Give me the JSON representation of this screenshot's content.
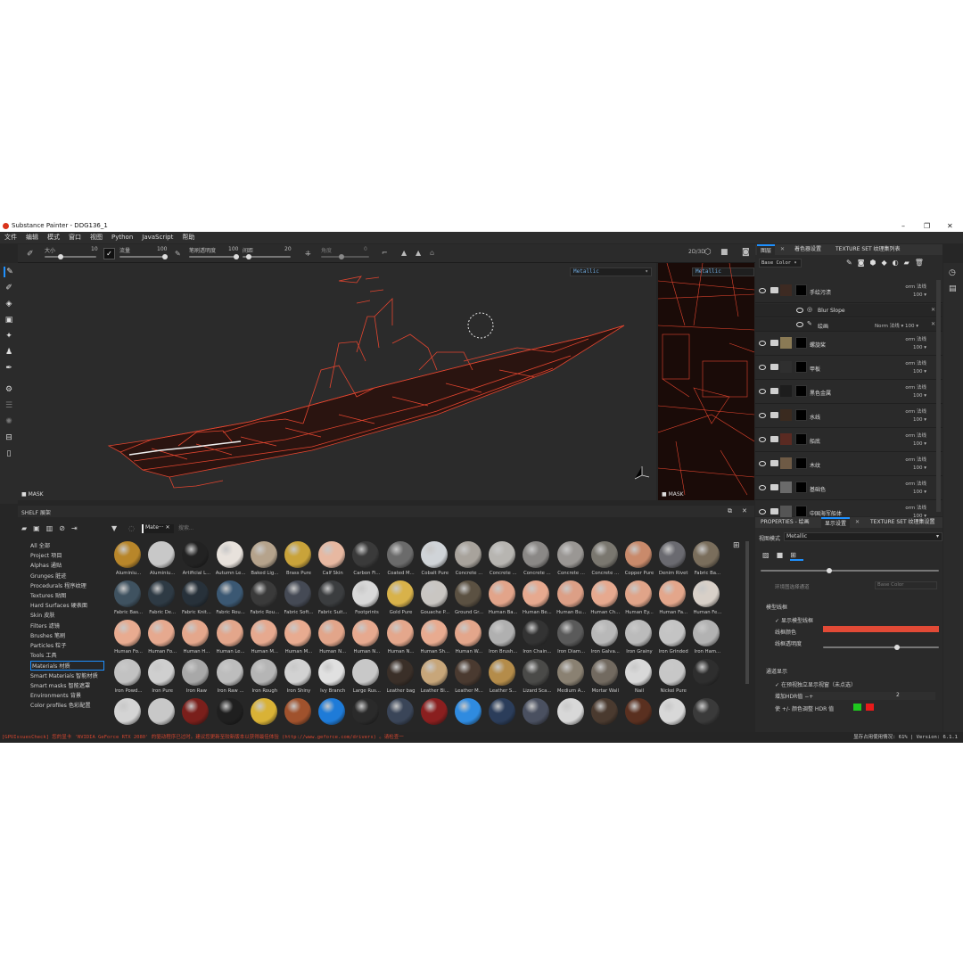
{
  "window": {
    "title": "Substance Painter - DDG136_1",
    "minimize": "–",
    "maximize": "❐",
    "close": "✕"
  },
  "menu": [
    "文件",
    "编辑",
    "模式",
    "窗口",
    "视图",
    "Python",
    "JavaScript",
    "帮助"
  ],
  "toolbar": {
    "size_label": "大小",
    "size_value": "10",
    "flow_label": "流量",
    "flow_value": "100",
    "opacity_label": "笔刷透明度",
    "opacity_value": "100",
    "spacing_label": "间距",
    "spacing_value": "20",
    "angle_label": "角度",
    "angle_value": "0",
    "mode_label": "2D/3D"
  },
  "viewport": {
    "channel": "Metallic",
    "mask_label": "MASK",
    "uv_channel": "Metallic",
    "uv_mask_label": "MASK"
  },
  "layers_panel": {
    "tabs": [
      "图层",
      "着色器设置",
      "TEXTURE SET 纹理集列表"
    ],
    "channel": "Base Color",
    "layers": [
      {
        "name": "手绘污渍",
        "mode": "orm 法线",
        "opacity": "100",
        "thumb": "#3d2a22"
      },
      {
        "name": "Blur Slope",
        "sub": true
      },
      {
        "name": "绘画",
        "sub": true,
        "mode": "Norm 法线",
        "opacity": "100"
      },
      {
        "name": "螺旋桨",
        "mode": "orm 法线",
        "opacity": "100",
        "thumb": "#8a7a55"
      },
      {
        "name": "甲板",
        "mode": "orm 法线",
        "opacity": "100",
        "thumb": "#2f2f2f"
      },
      {
        "name": "黑色金属",
        "mode": "orm 法线",
        "opacity": "100",
        "thumb": "#1d1d1d"
      },
      {
        "name": "水线",
        "mode": "orm 法线",
        "opacity": "100",
        "thumb": "#3a2a1f"
      },
      {
        "name": "船底",
        "mode": "orm 法线",
        "opacity": "100",
        "thumb": "#5a2a22"
      },
      {
        "name": "木纹",
        "mode": "orm 法线",
        "opacity": "100",
        "thumb": "#6e5a45"
      },
      {
        "name": "基础色",
        "mode": "orm 法线",
        "opacity": "100",
        "thumb": "#6a6a6a"
      },
      {
        "name": "中国海军船体",
        "mode": "orm 法线",
        "opacity": "100",
        "thumb": "#555"
      }
    ]
  },
  "properties": {
    "tabs": [
      "PROPERTIES - 绘画",
      "显示设置",
      "TEXTURE SET 纹理集设置"
    ],
    "view_mode_label": "视图模式",
    "view_mode": "Metallic",
    "envmap_label": "环境图选择通道",
    "envmap_value": "Base Color",
    "wireframe_section": "模型线框",
    "show_wireframe": "显示模型线框",
    "wire_color_label": "线框颜色",
    "wire_opacity_label": "线框透明度",
    "channel_section": "通道显示",
    "isolate_label": "在预视独立显示视窗（未点选）",
    "hdr_label": "增加HDR值",
    "hdr_value": "2",
    "color_adjust": "使 +/- 颜色调整 HDR 值",
    "wire_color": "#e24a36"
  },
  "shelf": {
    "title": "SHELF 展架",
    "filter": "Mate···",
    "search_placeholder": "搜索...",
    "categories": [
      "All 全部",
      "Project 项目",
      "Alphas 通贴",
      "Grunges 脏迹",
      "Procedurals 程序纹理",
      "Textures 贴图",
      "Hard Surfaces 硬表面",
      "Skin 皮肤",
      "Filters 滤镜",
      "Brushes 笔刷",
      "Particles 粒子",
      "Tools 工具",
      "Materials 材质",
      "Smart Materials 智能材质",
      "Smart masks 智能遮罩",
      "Environments 背景",
      "Color profiles 色彩配置"
    ],
    "selected_index": 12,
    "materials": [
      {
        "n": "Aluminiu...",
        "c": "#b8862a"
      },
      {
        "n": "Aluminiu...",
        "c": "#c8c8c8"
      },
      {
        "n": "Artificial L...",
        "c": "#222"
      },
      {
        "n": "Autumn Le...",
        "c": "#e8e2dc"
      },
      {
        "n": "Baked Lig...",
        "c": "#b5a38c"
      },
      {
        "n": "Brass Pure",
        "c": "#c9a33a"
      },
      {
        "n": "Calf Skin",
        "c": "#e7b8a1"
      },
      {
        "n": "Carbon Fi...",
        "c": "#3a3a3a"
      },
      {
        "n": "Coated M...",
        "c": "#6b6b6b"
      },
      {
        "n": "Cobalt Pure",
        "c": "#d0d4d8"
      },
      {
        "n": "Concrete ...",
        "c": "#a8a39c"
      },
      {
        "n": "Concrete ...",
        "c": "#b7b5b1"
      },
      {
        "n": "Concrete ...",
        "c": "#8a8886"
      },
      {
        "n": "Concrete ...",
        "c": "#9a9794"
      },
      {
        "n": "Concrete ...",
        "c": "#7a776f"
      },
      {
        "n": "Copper Pure",
        "c": "#c98a6b"
      },
      {
        "n": "Denim Rivet",
        "c": "#6a6a70"
      },
      {
        "n": "Fabric Ba...",
        "c": "#7a6e5c"
      },
      {
        "n": "Fabric Bas...",
        "c": "#3f5260"
      },
      {
        "n": "Fabric De...",
        "c": "#2e3a44"
      },
      {
        "n": "Fabric Knit...",
        "c": "#27313a"
      },
      {
        "n": "Fabric Rou...",
        "c": "#3b5873"
      },
      {
        "n": "Fabric Rou...",
        "c": "#3a3a3a"
      },
      {
        "n": "Fabric Soft...",
        "c": "#454a55"
      },
      {
        "n": "Fabric Suit...",
        "c": "#3b3d3f"
      },
      {
        "n": "Footprints",
        "c": "#d8d8d8"
      },
      {
        "n": "Gold Pure",
        "c": "#d8b24a"
      },
      {
        "n": "Gouache P...",
        "c": "#c9c6c2"
      },
      {
        "n": "Ground Gr...",
        "c": "#5b5142"
      },
      {
        "n": "Human Ba...",
        "c": "#e2a48a"
      },
      {
        "n": "Human Be...",
        "c": "#e6a98f"
      },
      {
        "n": "Human Bu...",
        "c": "#dc9f86"
      },
      {
        "n": "Human Ch...",
        "c": "#e6a98f"
      },
      {
        "n": "Human Ey...",
        "c": "#e0a489"
      },
      {
        "n": "Human Fa...",
        "c": "#e3a68b"
      },
      {
        "n": "Human Fe...",
        "c": "#d8d0c8"
      },
      {
        "n": "Human Fo...",
        "c": "#e8ab90"
      },
      {
        "n": "Human Fo...",
        "c": "#e6a98f"
      },
      {
        "n": "Human H...",
        "c": "#e4a78c"
      },
      {
        "n": "Human Le...",
        "c": "#e3a68b"
      },
      {
        "n": "Human M...",
        "c": "#e6a98f"
      },
      {
        "n": "Human M...",
        "c": "#e8ab90"
      },
      {
        "n": "Human N...",
        "c": "#e2a58a"
      },
      {
        "n": "Human N...",
        "c": "#e6a98f"
      },
      {
        "n": "Human N...",
        "c": "#e4a78c"
      },
      {
        "n": "Human Sh...",
        "c": "#e8ab90"
      },
      {
        "n": "Human W...",
        "c": "#e3a68b"
      },
      {
        "n": "Iron Brush...",
        "c": "#b0b0b0"
      },
      {
        "n": "Iron Chain...",
        "c": "#333"
      },
      {
        "n": "Iron Diam...",
        "c": "#5a5a5a"
      },
      {
        "n": "Iron Galva...",
        "c": "#b8b8b8"
      },
      {
        "n": "Iron Grainy",
        "c": "#bbbbbb"
      },
      {
        "n": "Iron Grinded",
        "c": "#c4c4c4"
      },
      {
        "n": "Iron Ham...",
        "c": "#b2b2b2"
      },
      {
        "n": "Iron Powd...",
        "c": "#c2c2c2"
      },
      {
        "n": "Iron Pure",
        "c": "#cfcfcf"
      },
      {
        "n": "Iron Raw",
        "c": "#a8a8a8"
      },
      {
        "n": "Iron Raw ...",
        "c": "#bdbdbd"
      },
      {
        "n": "Iron Rough",
        "c": "#b5b5b5"
      },
      {
        "n": "Iron Shiny",
        "c": "#d2d2d2"
      },
      {
        "n": "Ivy Branch",
        "c": "#e0e0e0"
      },
      {
        "n": "Large Rus...",
        "c": "#c8c8c8"
      },
      {
        "n": "Leather bag",
        "c": "#3a2f28"
      },
      {
        "n": "Leather Bi...",
        "c": "#c7a67a"
      },
      {
        "n": "Leather M...",
        "c": "#4a3a30"
      },
      {
        "n": "Leather S...",
        "c": "#b48c4a"
      },
      {
        "n": "Lizard Sca...",
        "c": "#4a4a48"
      },
      {
        "n": "Medium A...",
        "c": "#8a8172"
      },
      {
        "n": "Mortar Wall",
        "c": "#726a60"
      },
      {
        "n": "Nail",
        "c": "#d8d8d8"
      },
      {
        "n": "Nickel Pure",
        "c": "#c7c7c7"
      },
      {
        "n": "",
        "c": "#2e2e2e"
      },
      {
        "n": "",
        "c": "#d4d4d4"
      },
      {
        "n": "",
        "c": "#c8c8c8"
      },
      {
        "n": "",
        "c": "#7a1f1b"
      },
      {
        "n": "",
        "c": "#1f1f1f"
      },
      {
        "n": "",
        "c": "#d9b236"
      },
      {
        "n": "",
        "c": "#a0522d"
      },
      {
        "n": "",
        "c": "#1e7bd8"
      },
      {
        "n": "",
        "c": "#2a2a2a"
      },
      {
        "n": "",
        "c": "#3a4558"
      },
      {
        "n": "",
        "c": "#8a1f1f"
      },
      {
        "n": "",
        "c": "#2f8be0"
      },
      {
        "n": "",
        "c": "#2b3d5a"
      },
      {
        "n": "",
        "c": "#4a5060"
      },
      {
        "n": "",
        "c": "#d8d8d8"
      },
      {
        "n": "",
        "c": "#4a3a2f"
      },
      {
        "n": "",
        "c": "#5a3020"
      },
      {
        "n": "",
        "c": "#d8d8d8"
      },
      {
        "n": "",
        "c": "#3a3a3a"
      }
    ]
  },
  "status": {
    "message": "[GPUIssuesCheck] 您的显卡 'NVIDIA GeForce RTX 2080' 的驱动程序已过时。建议您更新至较新版本以获得最佳体验 (http://www.geforce.com/drivers) 。请检查一",
    "memory_label": "显存占用使用情况:",
    "memory_value": "61%",
    "version": "Version: 6.1.1"
  }
}
